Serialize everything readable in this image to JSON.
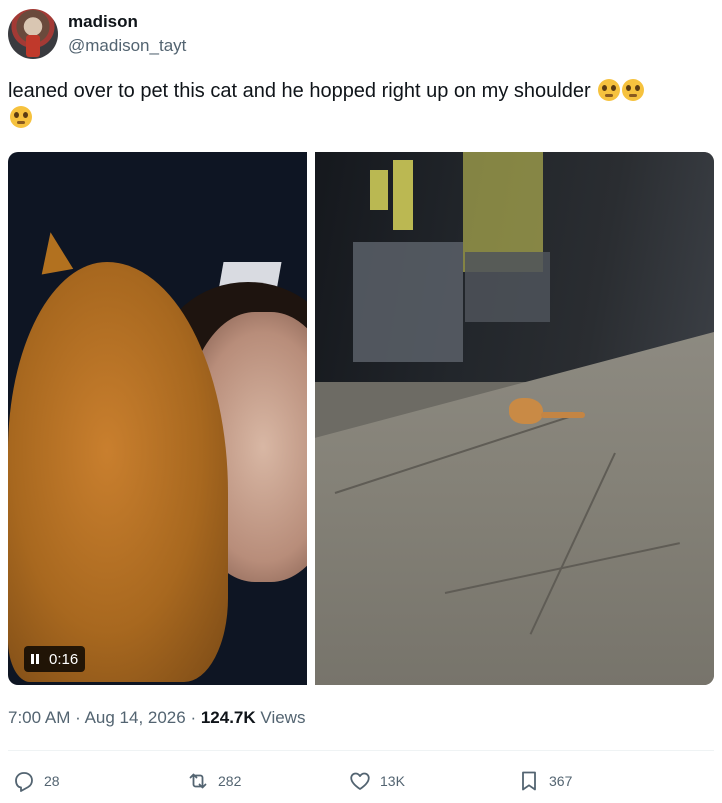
{
  "author": {
    "display_name": "madison",
    "handle": "@madison_tayt"
  },
  "tweet": {
    "text": "leaned over to pet this cat and he hopped right up on my shoulder",
    "emoji": [
      "pleading-face",
      "pleading-face",
      "pleading-face"
    ]
  },
  "media": {
    "video_duration": "0:16"
  },
  "meta": {
    "time": "7:00 AM",
    "date": "Aug 14, 2026",
    "views_count": "124.7K",
    "views_label": "Views"
  },
  "actions": {
    "replies": "28",
    "reposts": "282",
    "likes": "13K",
    "bookmarks": "367"
  },
  "colors": {
    "text": "#0f1419",
    "secondary": "#536471",
    "divider": "#eff3f4"
  }
}
